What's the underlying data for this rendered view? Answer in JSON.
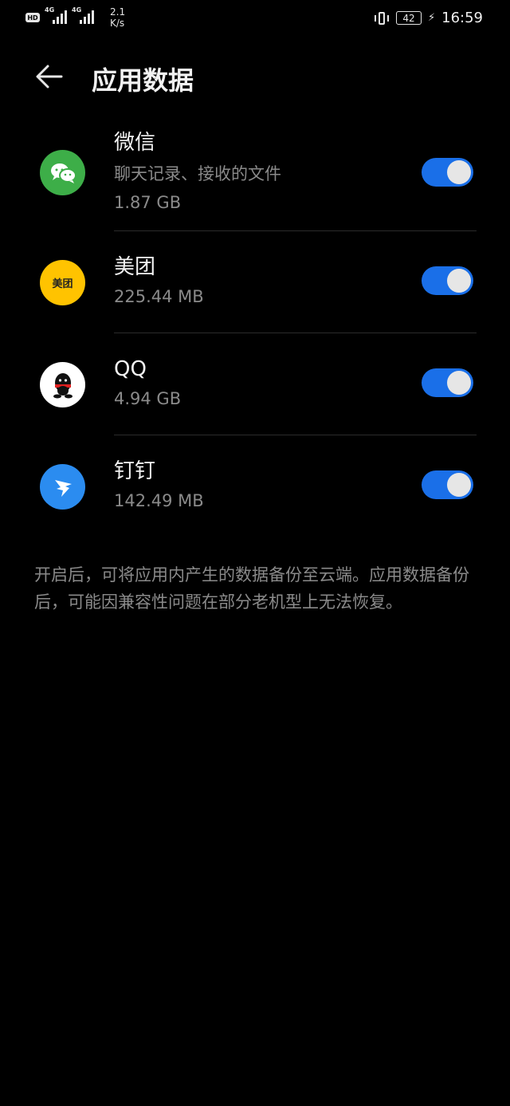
{
  "status_bar": {
    "signal1_label": "4G",
    "signal2_label": "4G",
    "net_speed_value": "2.1",
    "net_speed_unit": "K/s",
    "battery": "42",
    "time": "16:59"
  },
  "header": {
    "title": "应用数据"
  },
  "apps": [
    {
      "name": "微信",
      "description": "聊天记录、接收的文件",
      "size": "1.87 GB",
      "enabled": true
    },
    {
      "name": "美团",
      "icon_text": "美团",
      "size": "225.44 MB",
      "enabled": true
    },
    {
      "name": "QQ",
      "size": "4.94 GB",
      "enabled": true
    },
    {
      "name": "钉钉",
      "size": "142.49 MB",
      "enabled": true
    }
  ],
  "colors": {
    "accent": "#1a6fe8",
    "wechat_green": "#3dae48",
    "meituan_yellow": "#ffc300",
    "dingtalk_blue": "#2b8cf0"
  },
  "footer_note": "开启后，可将应用内产生的数据备份至云端。应用数据备份后，可能因兼容性问题在部分老机型上无法恢复。"
}
